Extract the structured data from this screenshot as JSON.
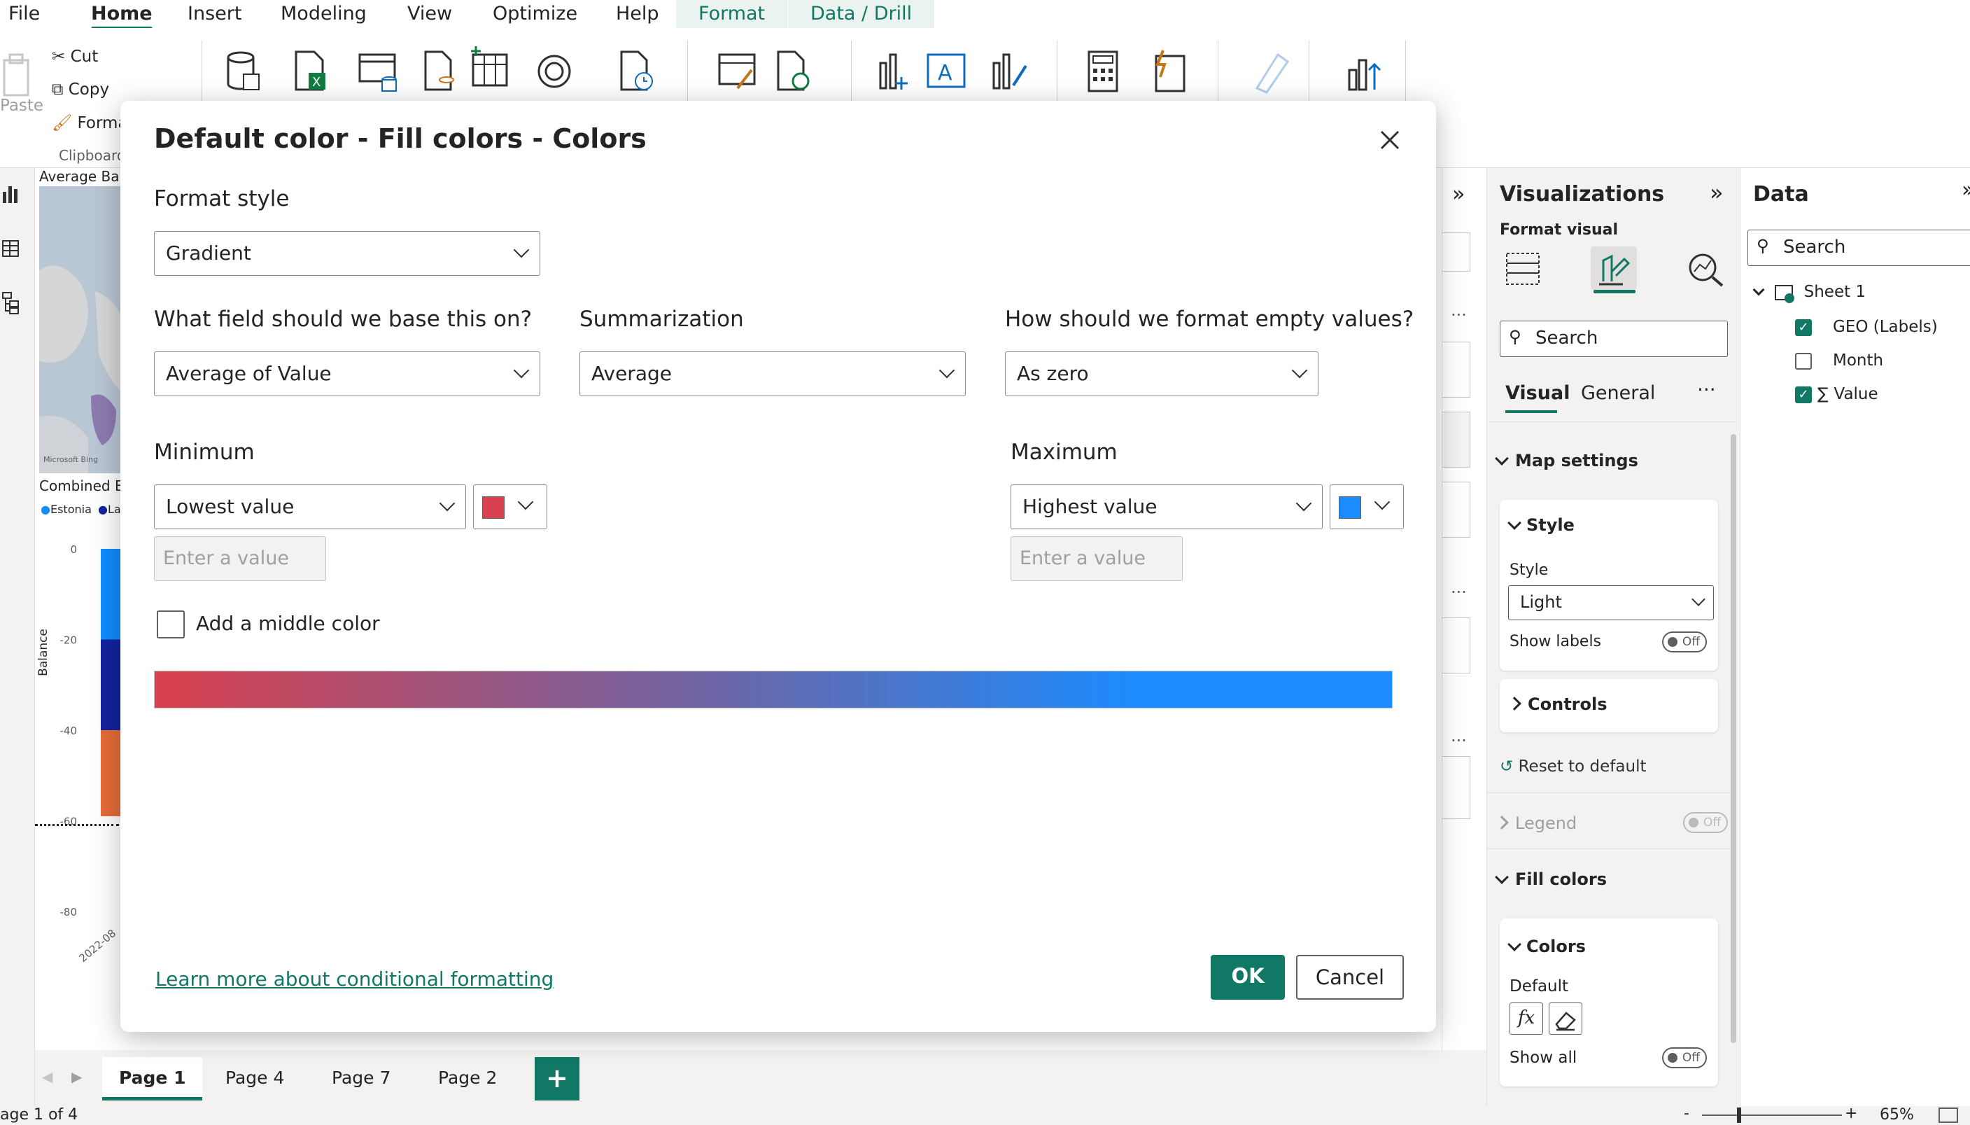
{
  "menu": {
    "items": [
      "File",
      "Home",
      "Insert",
      "Modeling",
      "View",
      "Optimize",
      "Help"
    ],
    "active": "Home",
    "contextual": [
      "Format",
      "Data / Drill"
    ]
  },
  "ribbon": {
    "paste_label": "Paste",
    "cut_label": "Cut",
    "copy_label": "Copy",
    "format_painter_label": "Forma",
    "clipboard_group": "Clipboard"
  },
  "canvas": {
    "visual1_title": "Average Bal",
    "map_credit": "Microsoft Bing",
    "visual2_title": "Combined B",
    "legend": [
      "Estonia",
      "Lat"
    ],
    "y_axis_label": "Balance",
    "y_ticks": [
      "0",
      "-20",
      "-40",
      "-60",
      "-80"
    ],
    "x_tick": "2022-08"
  },
  "chart_data": {
    "type": "bar",
    "title": "Combined B",
    "ylabel": "Balance",
    "ylim": [
      -80,
      0
    ],
    "categories": [
      "2022-08"
    ],
    "series": [
      {
        "name": "Estonia",
        "values": [
          -20
        ]
      },
      {
        "name": "Lat",
        "values": [
          -20
        ]
      },
      {
        "name": "",
        "values": [
          -19
        ]
      }
    ],
    "colors": [
      "#118dff",
      "#12239e",
      "#e66c37"
    ]
  },
  "dialog": {
    "title": "Default color - Fill colors - Colors",
    "format_style_label": "Format style",
    "format_style_value": "Gradient",
    "field_label": "What field should we base this on?",
    "field_value": "Average of Value",
    "summarization_label": "Summarization",
    "summarization_value": "Average",
    "empty_label": "How should we format empty values?",
    "empty_value": "As zero",
    "minimum_label": "Minimum",
    "minimum_value": "Lowest value",
    "minimum_color": "#d9414e",
    "minimum_placeholder": "Enter a value",
    "maximum_label": "Maximum",
    "maximum_value": "Highest value",
    "maximum_color": "#1a8cff",
    "maximum_placeholder": "Enter a value",
    "middle_color_label": "Add a middle color",
    "middle_color_checked": false,
    "learn_more": "Learn more about conditional formatting",
    "ok_label": "OK",
    "cancel_label": "Cancel"
  },
  "viz": {
    "title": "Visualizations",
    "format_visual": "Format visual",
    "search_placeholder": "Search",
    "tab_visual": "Visual",
    "tab_general": "General",
    "map_settings": "Map settings",
    "style_header": "Style",
    "style_label": "Style",
    "style_value": "Light",
    "show_labels": "Show labels",
    "show_labels_state": "Off",
    "controls": "Controls",
    "reset": "Reset to default",
    "legend": "Legend",
    "legend_state": "Off",
    "fill_colors": "Fill colors",
    "colors": "Colors",
    "default": "Default",
    "fx": "fx",
    "show_all": "Show all",
    "show_all_state": "Off"
  },
  "data": {
    "title": "Data",
    "search_placeholder": "Search",
    "table": "Sheet 1",
    "fields": [
      {
        "name": "GEO (Labels)",
        "checked": true
      },
      {
        "name": "Month",
        "checked": false
      },
      {
        "name": "Value",
        "checked": true,
        "sigma": "∑"
      }
    ]
  },
  "pages": {
    "tabs": [
      "Page 1",
      "Page 4",
      "Page 7",
      "Page 2"
    ],
    "active": "Page 1",
    "add": "+"
  },
  "status": {
    "page_info": "age 1 of 4",
    "zoom": "65%",
    "minus": "-",
    "plus": "+"
  },
  "colors": {
    "accent": "#117865",
    "gradient_start": "#d9414e",
    "gradient_end": "#1a8cff"
  }
}
